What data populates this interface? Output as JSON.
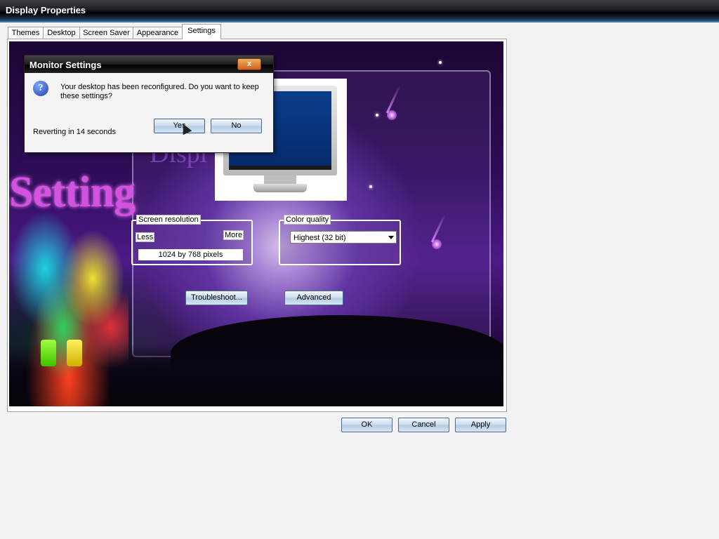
{
  "window": {
    "title": "Display Properties"
  },
  "tabs": [
    {
      "label": "Themes"
    },
    {
      "label": "Desktop"
    },
    {
      "label": "Screen Saver"
    },
    {
      "label": "Appearance"
    },
    {
      "label": "Settings",
      "active": true
    }
  ],
  "background_art": {
    "setting_text": "Setting",
    "display_text": "Displ"
  },
  "screen_resolution": {
    "legend": "Screen resolution",
    "less_label": "Less",
    "more_label": "More",
    "value": "1024 by 768 pixels"
  },
  "color_quality": {
    "legend": "Color quality",
    "selected": "Highest (32 bit)"
  },
  "buttons": {
    "troubleshoot": "Troubleshoot...",
    "advanced": "Advanced",
    "ok": "OK",
    "cancel": "Cancel",
    "apply": "Apply"
  },
  "dialog": {
    "title": "Monitor Settings",
    "close_label": "x",
    "message": "Your desktop has been reconfigured.  Do you want to keep these settings?",
    "countdown": "Reverting in 14 seconds",
    "yes_label": "Yes",
    "no_label": "No"
  },
  "colors": {
    "titlebar": "#1e2024",
    "panel_accent": "#4b1a87",
    "button_border": "#4d6a8a"
  }
}
